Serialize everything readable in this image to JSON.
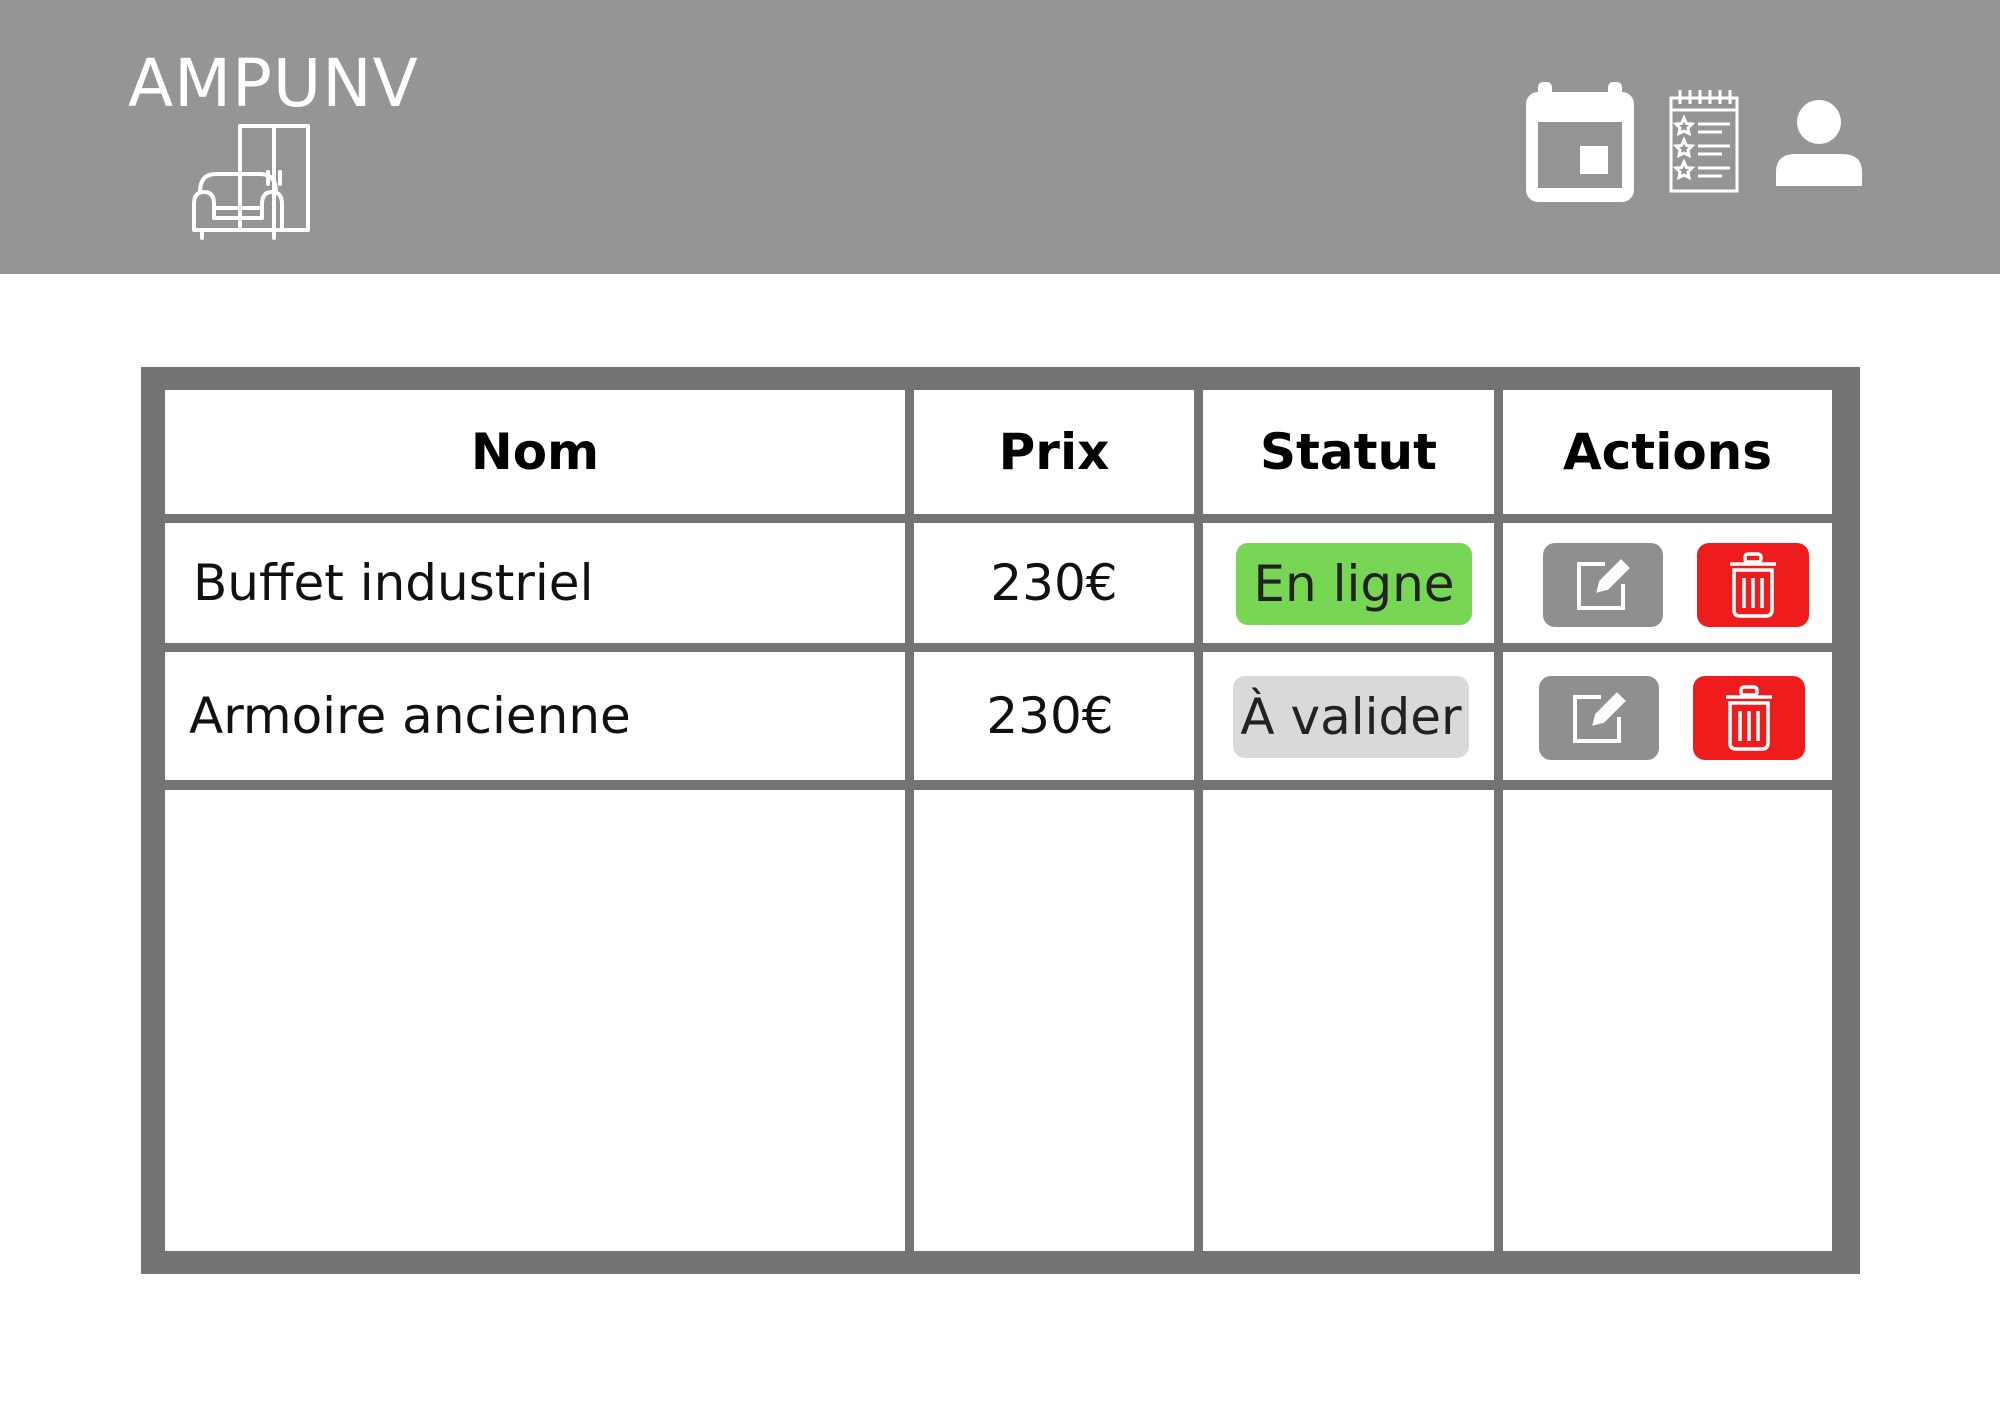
{
  "header": {
    "logo_text": "AMPUNV",
    "logo_icon": "furniture-icon",
    "icons": [
      "calendar-icon",
      "notepad-icon",
      "user-icon"
    ]
  },
  "colors": {
    "header_bg": "#959595",
    "table_border": "#747474",
    "status_online": "#77d654",
    "status_pending": "#d9d9d9",
    "edit_button": "#8f8f8f",
    "delete_button": "#ee1c1c"
  },
  "table": {
    "columns": [
      "Nom",
      "Prix",
      "Statut",
      "Actions"
    ],
    "rows": [
      {
        "name": "Buffet industriel",
        "price": "230€",
        "status": "En ligne",
        "status_type": "online"
      },
      {
        "name": "Armoire ancienne",
        "price": "230€",
        "status": "À valider",
        "status_type": "pending"
      }
    ],
    "row_actions": [
      "edit-icon",
      "trash-icon"
    ]
  }
}
